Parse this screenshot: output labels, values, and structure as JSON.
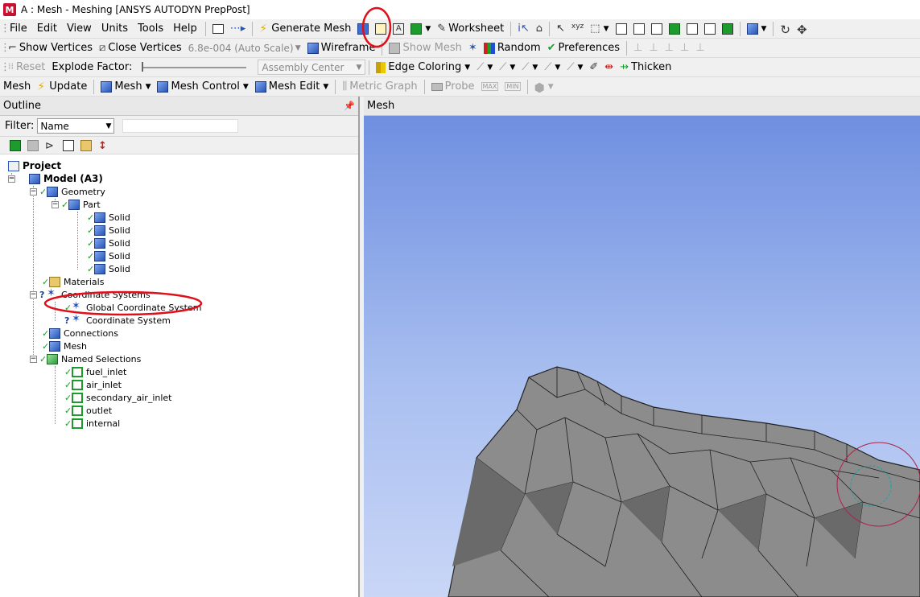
{
  "window": {
    "title": "A : Mesh - Meshing [ANSYS AUTODYN PrepPost]",
    "app_icon_letter": "M"
  },
  "menu": {
    "items": [
      "File",
      "Edit",
      "View",
      "Units",
      "Tools",
      "Help"
    ]
  },
  "toolbar1": {
    "generate_mesh": "Generate Mesh",
    "worksheet": "Worksheet"
  },
  "toolbar2": {
    "show_vertices": "Show Vertices",
    "close_vertices": "Close Vertices",
    "scale_value": "6.8e-004 (Auto Scale)",
    "wireframe": "Wireframe",
    "show_mesh": "Show Mesh",
    "random": "Random",
    "preferences": "Preferences"
  },
  "toolbar3": {
    "reset": "Reset",
    "explode_factor": "Explode Factor:",
    "assembly_center": "Assembly Center",
    "edge_coloring": "Edge Coloring",
    "thicken": "Thicken"
  },
  "toolbar4": {
    "mesh_label": "Mesh",
    "update": "Update",
    "mesh_menu": "Mesh",
    "mesh_control": "Mesh Control",
    "mesh_edit": "Mesh Edit",
    "metric_graph": "Metric Graph",
    "probe": "Probe",
    "max": "MAX",
    "min": "MIN"
  },
  "outline": {
    "header": "Outline",
    "filter_label": "Filter:",
    "filter_value": "Name",
    "tree": {
      "project": "Project",
      "model": "Model (A3)",
      "geometry": "Geometry",
      "part": "Part",
      "solids": [
        "Solid",
        "Solid",
        "Solid",
        "Solid",
        "Solid"
      ],
      "materials": "Materials",
      "coordinate_systems": "Coordinate Systems",
      "global_cs": "Global Coordinate System",
      "coordinate_system": "Coordinate System",
      "connections": "Connections",
      "mesh": "Mesh",
      "named_selections": "Named Selections",
      "selections": [
        "fuel_inlet",
        "air_inlet",
        "secondary_air_inlet",
        "outlet",
        "internal"
      ]
    }
  },
  "viewport": {
    "header": "Mesh",
    "background_top": "#6f8fe0",
    "background_bottom": "#c9d6f6",
    "mesh_color": "#8c8c8c"
  },
  "annotations": {
    "color": "#e0101a"
  }
}
